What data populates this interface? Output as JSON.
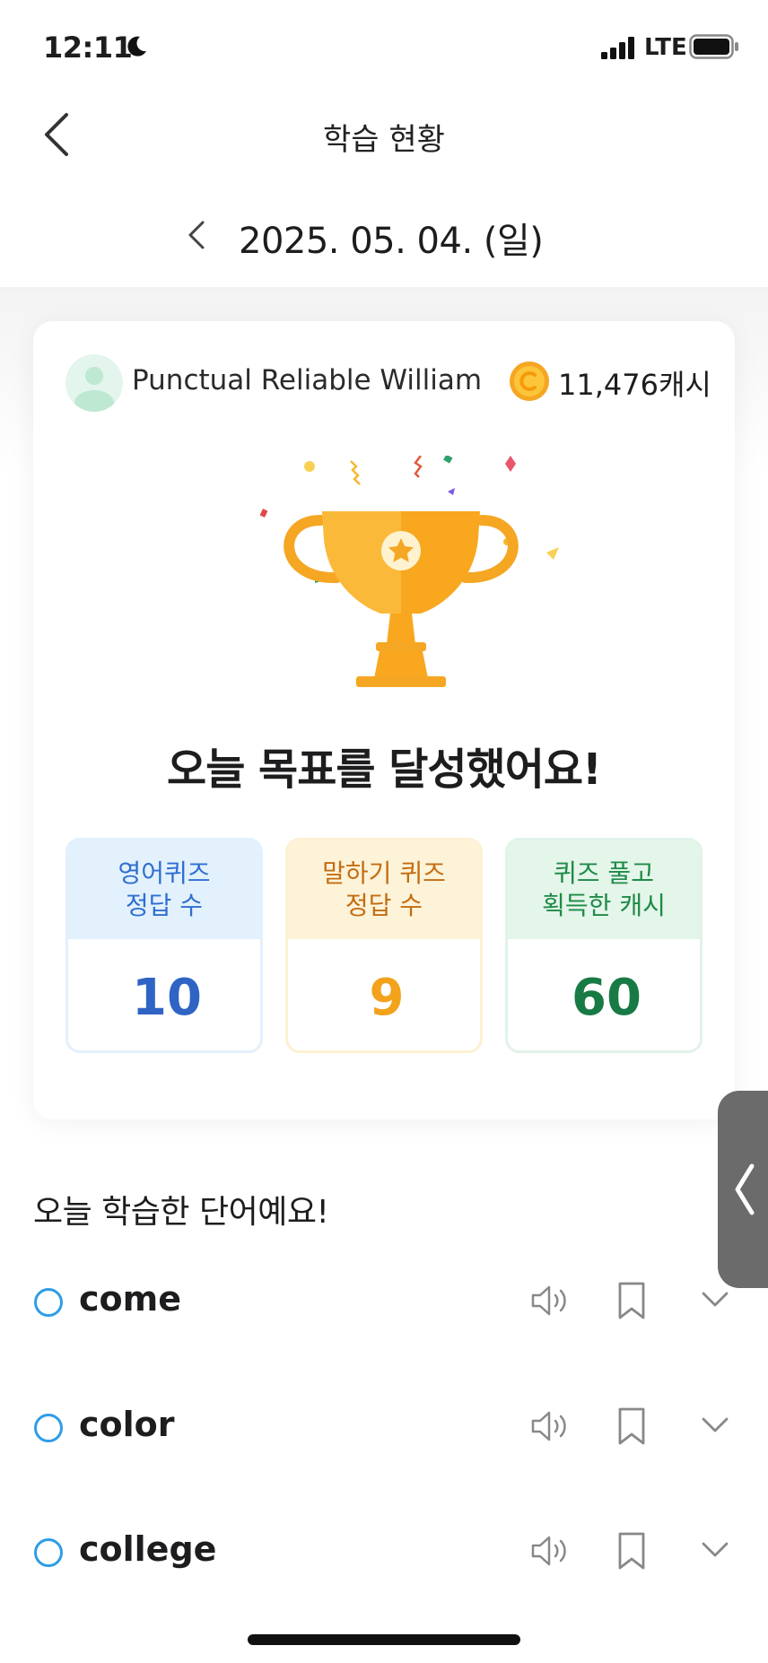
{
  "status_bar": {
    "time": "12:11",
    "network": "LTE"
  },
  "header": {
    "title": "학습 현황"
  },
  "date_nav": {
    "date": "2025. 05. 04. (일)"
  },
  "profile": {
    "name": "Punctual Reliable William",
    "cash": "11,476캐시"
  },
  "goal": {
    "message": "오늘 목표를 달성했어요!"
  },
  "stats": [
    {
      "label": "영어퀴즈\n정답 수",
      "value": "10",
      "color": "#2f64c5"
    },
    {
      "label": "말하기 퀴즈\n정답 수",
      "value": "9",
      "color": "#f2a21b"
    },
    {
      "label": "퀴즈 풀고\n획득한 캐시",
      "value": "60",
      "color": "#187a44"
    }
  ],
  "words_section": {
    "heading": "오늘 학습한 단어예요!",
    "words": [
      {
        "word": "come"
      },
      {
        "word": "color"
      },
      {
        "word": "college"
      }
    ]
  },
  "icons": [
    "moon-icon",
    "signal-icon",
    "battery-icon",
    "back-arrow-icon",
    "chevron-left-icon",
    "user-avatar-icon",
    "coin-icon",
    "trophy-icon",
    "speaker-icon",
    "bookmark-icon",
    "chevron-down-icon"
  ]
}
